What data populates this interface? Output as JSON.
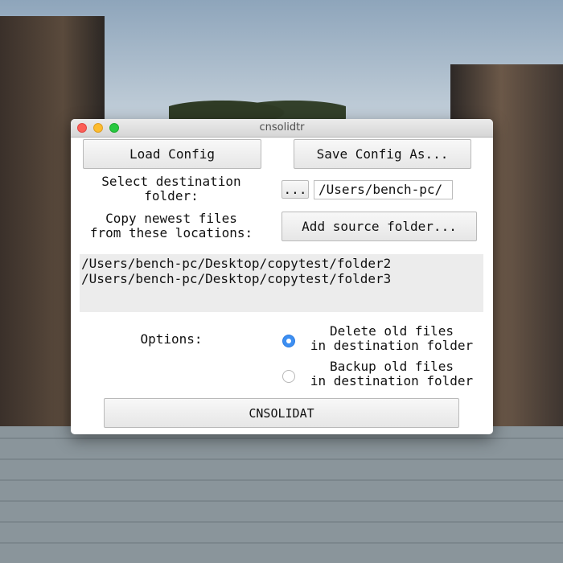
{
  "window": {
    "title": "cnsolidtr"
  },
  "toolbar": {
    "load_label": "Load Config",
    "save_label": "Save Config As..."
  },
  "destination": {
    "label_line1": "Select destination",
    "label_line2": "folder:",
    "browse_label": "...",
    "path_value": "/Users/bench-pc/"
  },
  "sources": {
    "label_line1": "Copy newest files",
    "label_line2": "from these locations:",
    "add_label": "Add source folder...",
    "items": [
      "/Users/bench-pc/Desktop/copytest/folder2",
      "/Users/bench-pc/Desktop/copytest/folder3"
    ]
  },
  "options": {
    "label": "Options:",
    "delete": {
      "line1": "Delete old files",
      "line2": "in destination folder",
      "selected": true
    },
    "backup": {
      "line1": "Backup old files",
      "line2": "in destination folder",
      "selected": false
    }
  },
  "action": {
    "run_label": "CNSOLIDAT"
  },
  "colors": {
    "accent": "#3d8ff2",
    "close": "#fc5f57",
    "minimize": "#fdbc2e",
    "maximize": "#28c840"
  }
}
